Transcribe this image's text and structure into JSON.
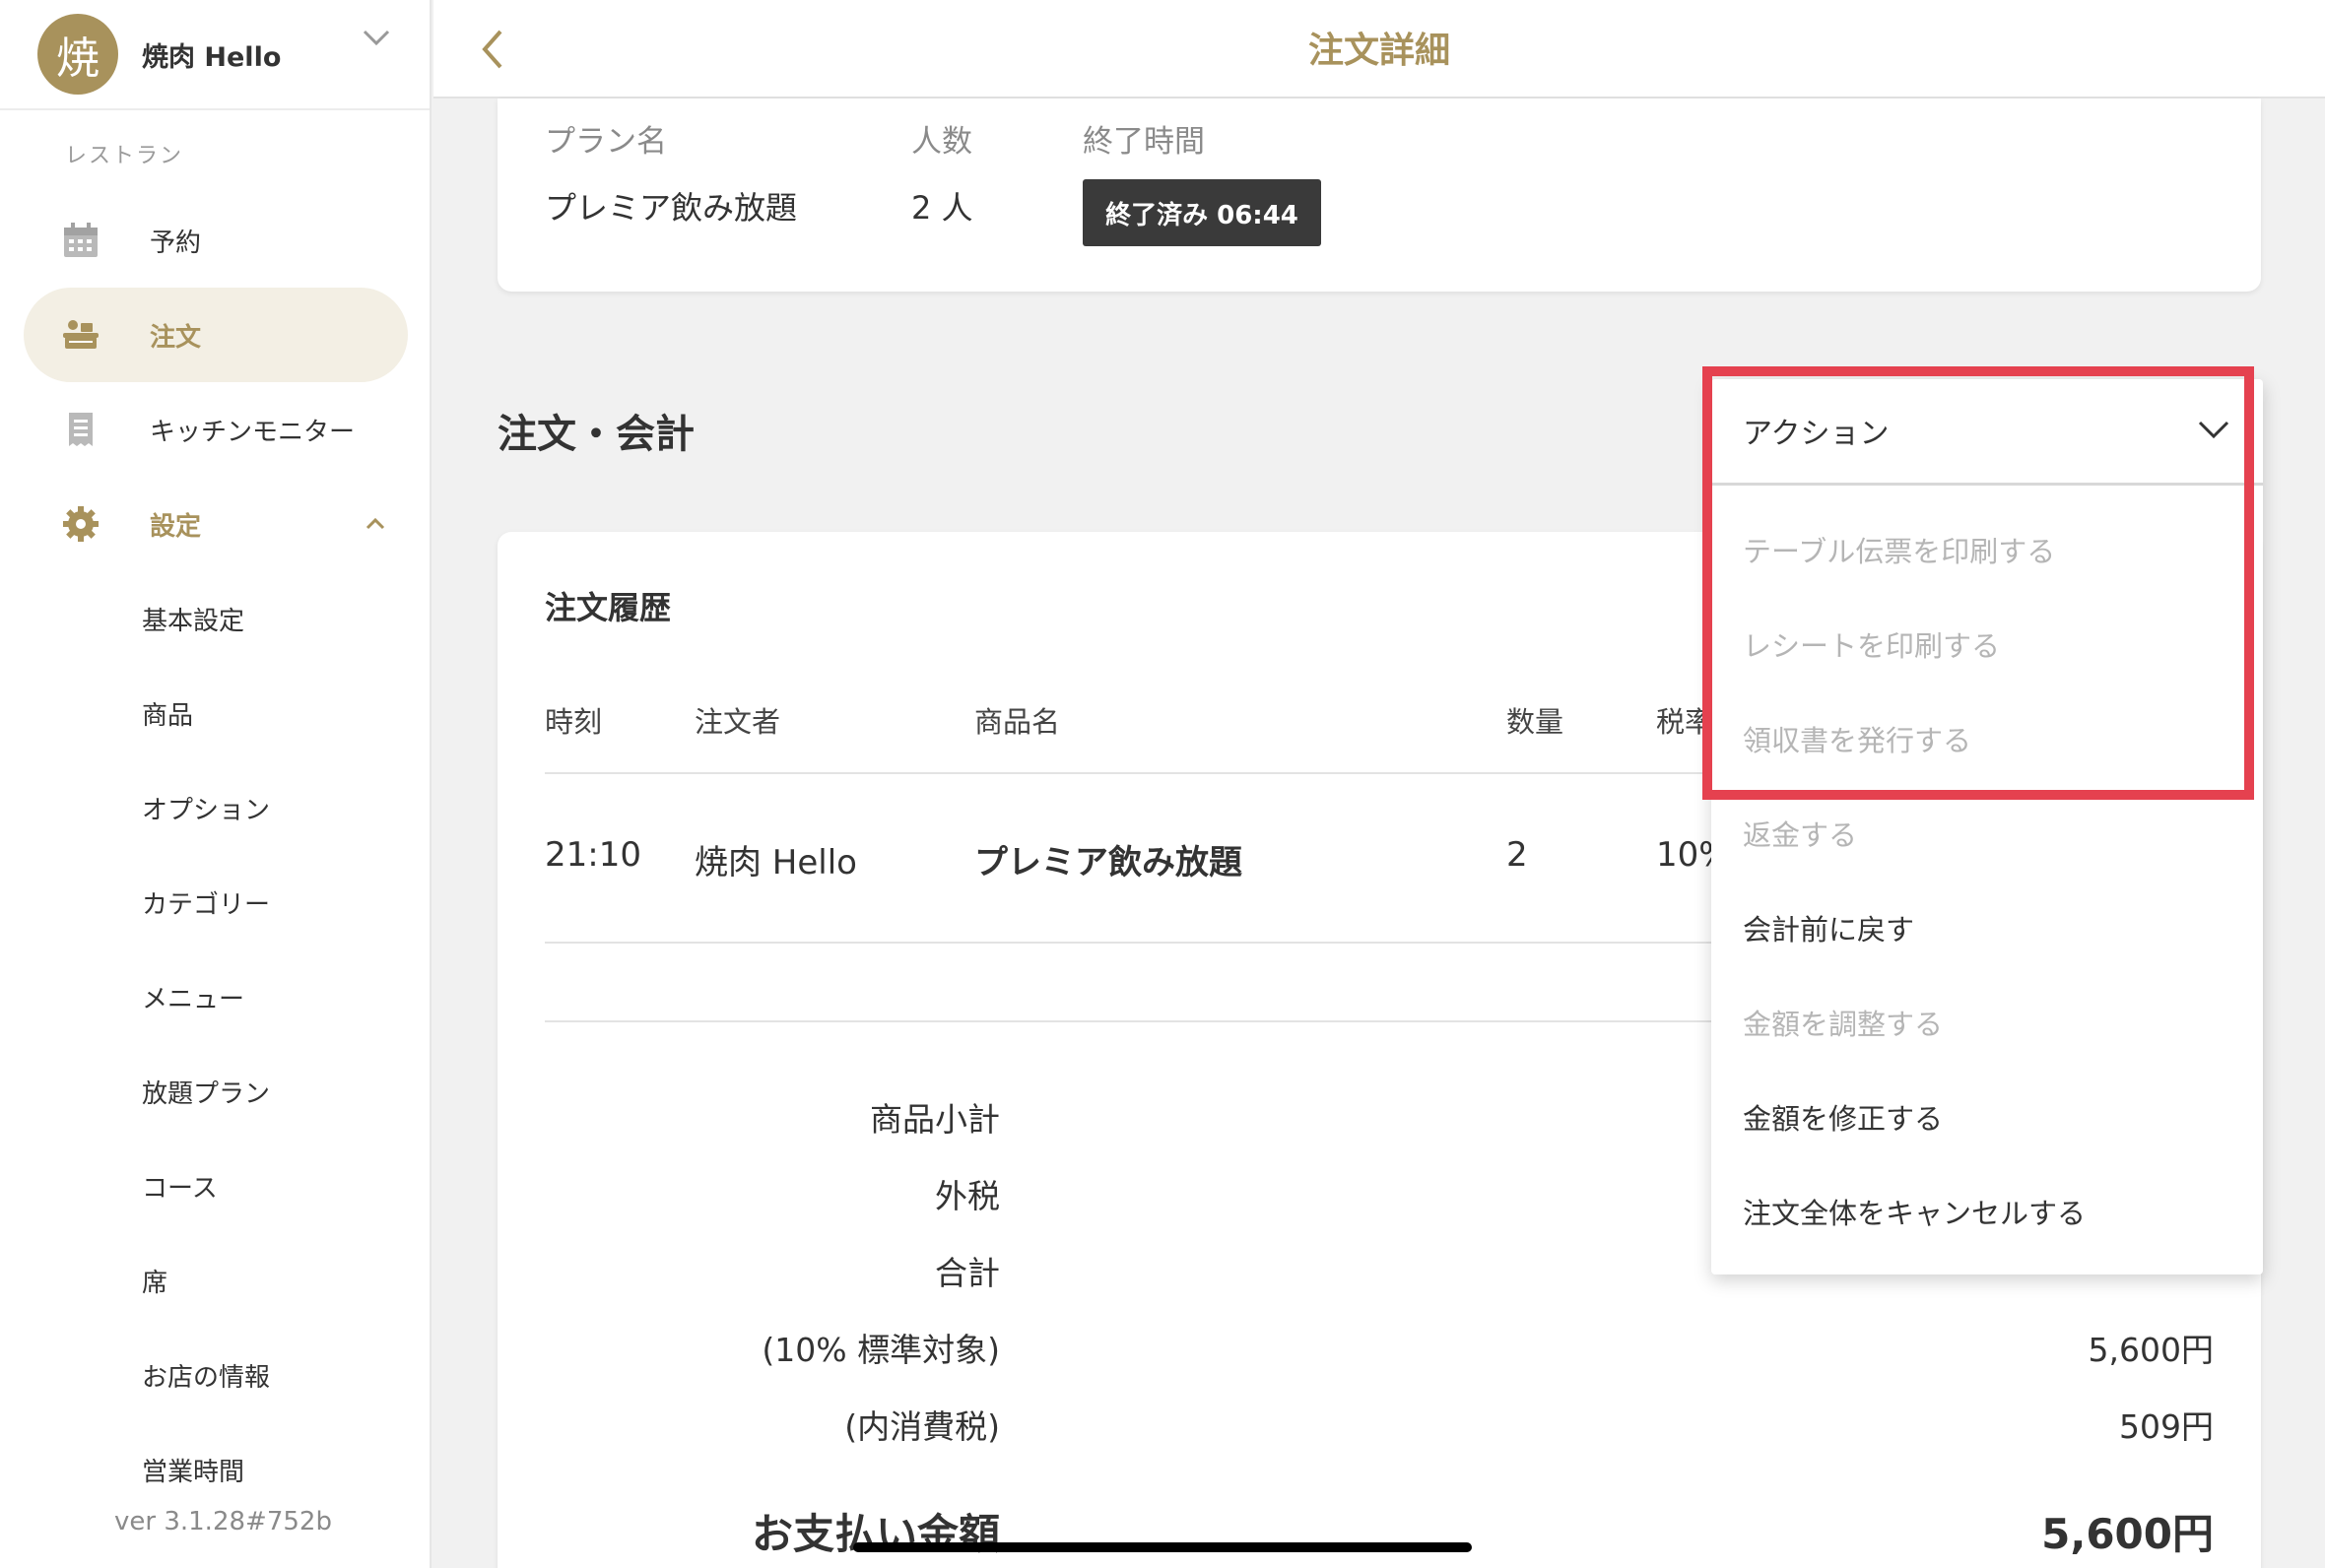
{
  "store": {
    "avatar_char": "焼",
    "name": "焼肉 Hello"
  },
  "sidebar": {
    "section_label": "レストラン",
    "nav": [
      {
        "label": "予約",
        "icon": "calendar-icon"
      },
      {
        "label": "注文",
        "icon": "order-tray-icon"
      },
      {
        "label": "キッチンモニター",
        "icon": "receipt-icon"
      },
      {
        "label": "設定",
        "icon": "gear-icon"
      }
    ],
    "settings_items": [
      "基本設定",
      "商品",
      "オプション",
      "カテゴリー",
      "メニュー",
      "放題プラン",
      "コース",
      "席",
      "お店の情報",
      "営業時間"
    ],
    "version": "ver 3.1.28#752b"
  },
  "header": {
    "title": "注文詳細"
  },
  "plan": {
    "headers": {
      "plan_name": "プラン名",
      "people": "人数",
      "end_time": "終了時間"
    },
    "values": {
      "plan_name": "プレミア飲み放題",
      "people": "2 人",
      "end_time_badge": "終了済み 06:44"
    }
  },
  "order_section": {
    "title": "注文・会計"
  },
  "order_history": {
    "title": "注文履歴",
    "columns": [
      "時刻",
      "注文者",
      "商品名",
      "数量",
      "税率"
    ],
    "rows": [
      {
        "time": "21:10",
        "orderer": "焼肉 Hello",
        "product": "プレミア飲み放題",
        "qty": "2",
        "tax": "10%"
      }
    ]
  },
  "summary": [
    {
      "label": "商品小計",
      "value": ""
    },
    {
      "label": "外税",
      "value": ""
    },
    {
      "label": "合計",
      "value": ""
    },
    {
      "label": "(10% 標準対象)",
      "value": "5,600円"
    },
    {
      "label": "(内消費税)",
      "value": "509円"
    }
  ],
  "payment": {
    "label": "お支払い金額",
    "value": "5,600円"
  },
  "action_menu": {
    "label": "アクション",
    "items": [
      {
        "label": "テーブル伝票を印刷する",
        "enabled": false
      },
      {
        "label": "レシートを印刷する",
        "enabled": false
      },
      {
        "label": "領収書を発行する",
        "enabled": false
      },
      {
        "label": "返金する",
        "enabled": false
      },
      {
        "label": "会計前に戻す",
        "enabled": true
      },
      {
        "label": "金額を調整する",
        "enabled": false
      },
      {
        "label": "金額を修正する",
        "enabled": true
      },
      {
        "label": "注文全体をキャンセルする",
        "enabled": true
      }
    ]
  },
  "colors": {
    "accent": "#a8925c",
    "highlight": "#e5414f",
    "badge_bg": "#3a3a3a"
  }
}
